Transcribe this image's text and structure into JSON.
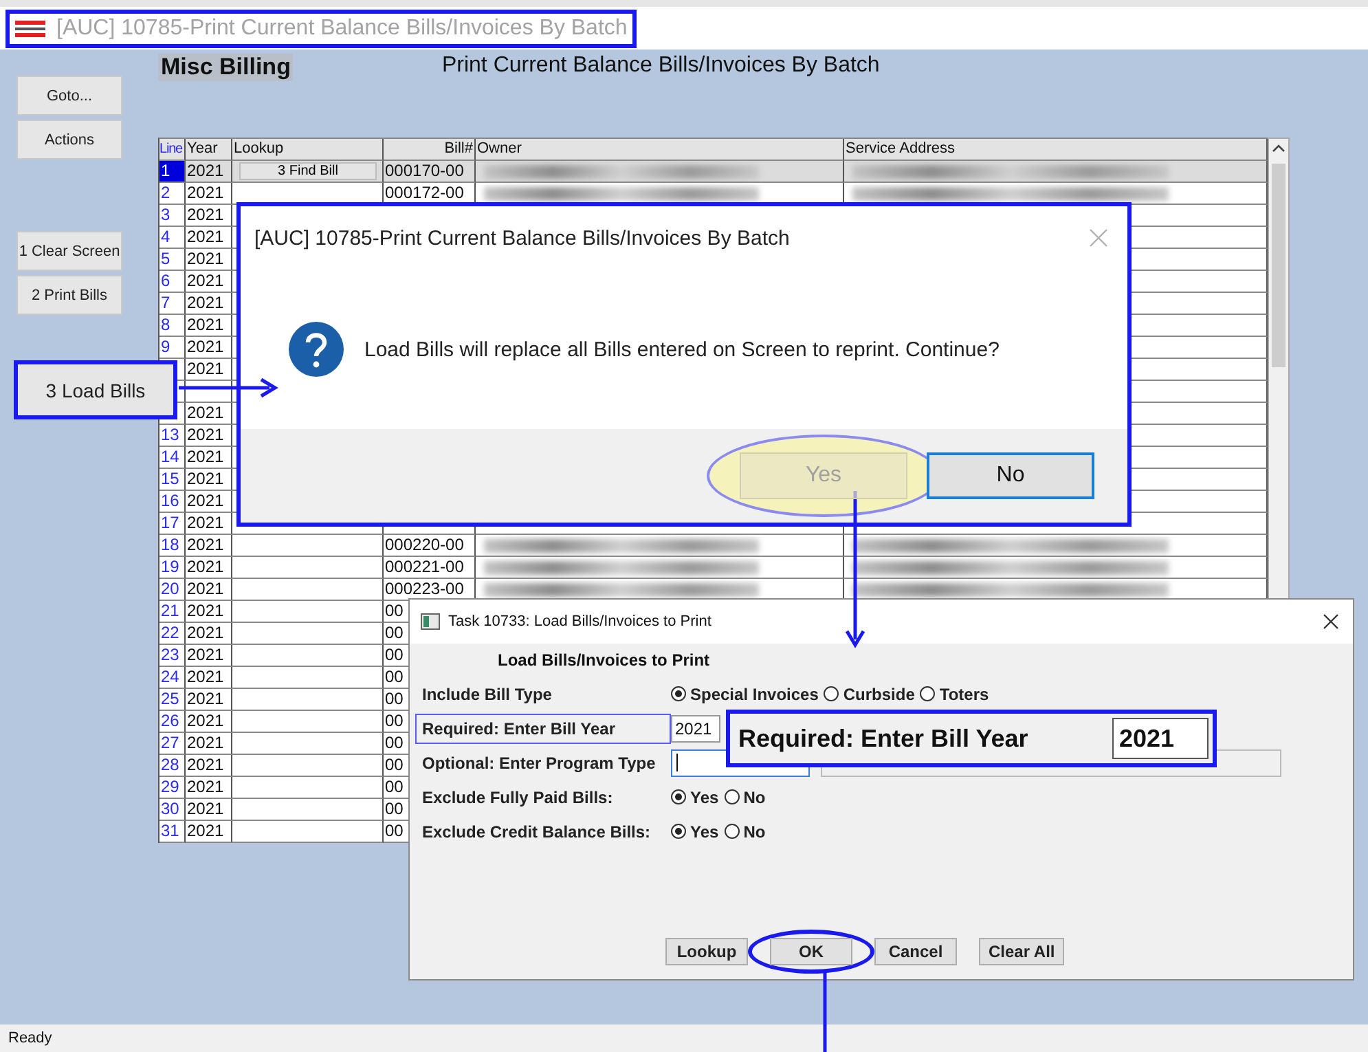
{
  "window": {
    "title": "[AUC] 10785-Print Current Balance Bills/Invoices By Batch"
  },
  "header": {
    "module": "Misc Billing",
    "title": "Print Current Balance Bills/Invoices By Batch"
  },
  "side_buttons": [
    {
      "label": "Goto..."
    },
    {
      "label": "Actions"
    },
    {
      "label": "1 Clear Screen"
    },
    {
      "label": "2 Print Bills"
    }
  ],
  "callout_button": {
    "label": "3 Load Bills"
  },
  "table": {
    "columns": [
      "Line",
      "Year",
      "Lookup",
      "Bill#",
      "Owner",
      "Service Address"
    ],
    "rows": [
      {
        "line": "1",
        "year": "2021",
        "lookup": "3 Find Bill",
        "bill": "000170-00",
        "blurred": true,
        "selected": true
      },
      {
        "line": "2",
        "year": "2021",
        "bill": "000172-00",
        "blurred": true,
        "selected": false
      },
      {
        "line": "3",
        "year": "2021",
        "selected": false
      },
      {
        "line": "4",
        "year": "2021",
        "selected": false
      },
      {
        "line": "5",
        "year": "2021",
        "selected": false
      },
      {
        "line": "6",
        "year": "2021",
        "selected": false
      },
      {
        "line": "7",
        "year": "2021",
        "selected": false
      },
      {
        "line": "8",
        "year": "2021",
        "selected": false
      },
      {
        "line": "9",
        "year": "2021",
        "selected": false
      },
      {
        "year": "2021",
        "selected": false
      },
      {
        "selected": false
      },
      {
        "year": "2021",
        "selected": false
      },
      {
        "line": "13",
        "year": "2021",
        "selected": false
      },
      {
        "line": "14",
        "year": "2021",
        "selected": false
      },
      {
        "line": "15",
        "year": "2021",
        "selected": false
      },
      {
        "line": "16",
        "year": "2021",
        "selected": false
      },
      {
        "line": "17",
        "year": "2021",
        "selected": false
      },
      {
        "line": "18",
        "year": "2021",
        "bill": "000220-00",
        "blurred": true,
        "selected": false
      },
      {
        "line": "19",
        "year": "2021",
        "bill": "000221-00",
        "blurred": true,
        "selected": false
      },
      {
        "line": "20",
        "year": "2021",
        "bill": "000223-00",
        "blurred": true,
        "selected": false
      },
      {
        "line": "21",
        "year": "2021",
        "bill": "00",
        "selected": false
      },
      {
        "line": "22",
        "year": "2021",
        "bill": "00",
        "selected": false
      },
      {
        "line": "23",
        "year": "2021",
        "bill": "00",
        "selected": false
      },
      {
        "line": "24",
        "year": "2021",
        "bill": "00",
        "selected": false
      },
      {
        "line": "25",
        "year": "2021",
        "bill": "00",
        "selected": false
      },
      {
        "line": "26",
        "year": "2021",
        "bill": "00",
        "selected": false
      },
      {
        "line": "27",
        "year": "2021",
        "bill": "00",
        "selected": false
      },
      {
        "line": "28",
        "year": "2021",
        "bill": "00",
        "selected": false
      },
      {
        "line": "29",
        "year": "2021",
        "bill": "00",
        "selected": false
      },
      {
        "line": "30",
        "year": "2021",
        "bill": "00",
        "selected": false
      },
      {
        "line": "31",
        "year": "2021",
        "bill": "00",
        "selected": false
      }
    ]
  },
  "message_dialog": {
    "title": "[AUC] 10785-Print Current Balance Bills/Invoices By Batch",
    "message": "Load Bills will replace all Bills entered on Screen to reprint. Continue?",
    "buttons": [
      {
        "label": "Yes",
        "disabled": true,
        "focused": false,
        "highlighted": true
      },
      {
        "label": "No",
        "disabled": false,
        "focused": true,
        "highlighted": false
      }
    ]
  },
  "load_dialog": {
    "title": "Task 10733: Load Bills/Invoices to Print",
    "heading": "Load Bills/Invoices to Print",
    "fields": [
      {
        "kind": "radio",
        "label": "Include Bill Type",
        "options": [
          {
            "label": "Special Invoices",
            "checked": true
          },
          {
            "label": "Curbside",
            "checked": false
          },
          {
            "label": "Toters",
            "checked": false
          }
        ]
      },
      {
        "kind": "text",
        "label": "Required: Enter Bill Year",
        "value": "2021",
        "outlined": true
      },
      {
        "kind": "text_pair",
        "label": "Optional: Enter Program Type",
        "focused": true,
        "outlined": false
      },
      {
        "kind": "radio",
        "label": "Exclude Fully Paid Bills:",
        "options": [
          {
            "label": "Yes",
            "checked": true
          },
          {
            "label": "No",
            "checked": false
          }
        ]
      },
      {
        "kind": "radio",
        "label": "Exclude Credit Balance Bills:",
        "options": [
          {
            "label": "Yes",
            "checked": true
          },
          {
            "label": "No",
            "checked": false
          }
        ]
      }
    ],
    "buttons": [
      {
        "label": "Lookup",
        "highlighted": false
      },
      {
        "label": "OK",
        "highlighted": true
      },
      {
        "label": "Cancel",
        "highlighted": false
      },
      {
        "label": "Clear All",
        "highlighted": false
      }
    ]
  },
  "zoom_callout": {
    "label": "Required: Enter Bill Year",
    "value": "2021"
  },
  "status_bar": "Ready"
}
